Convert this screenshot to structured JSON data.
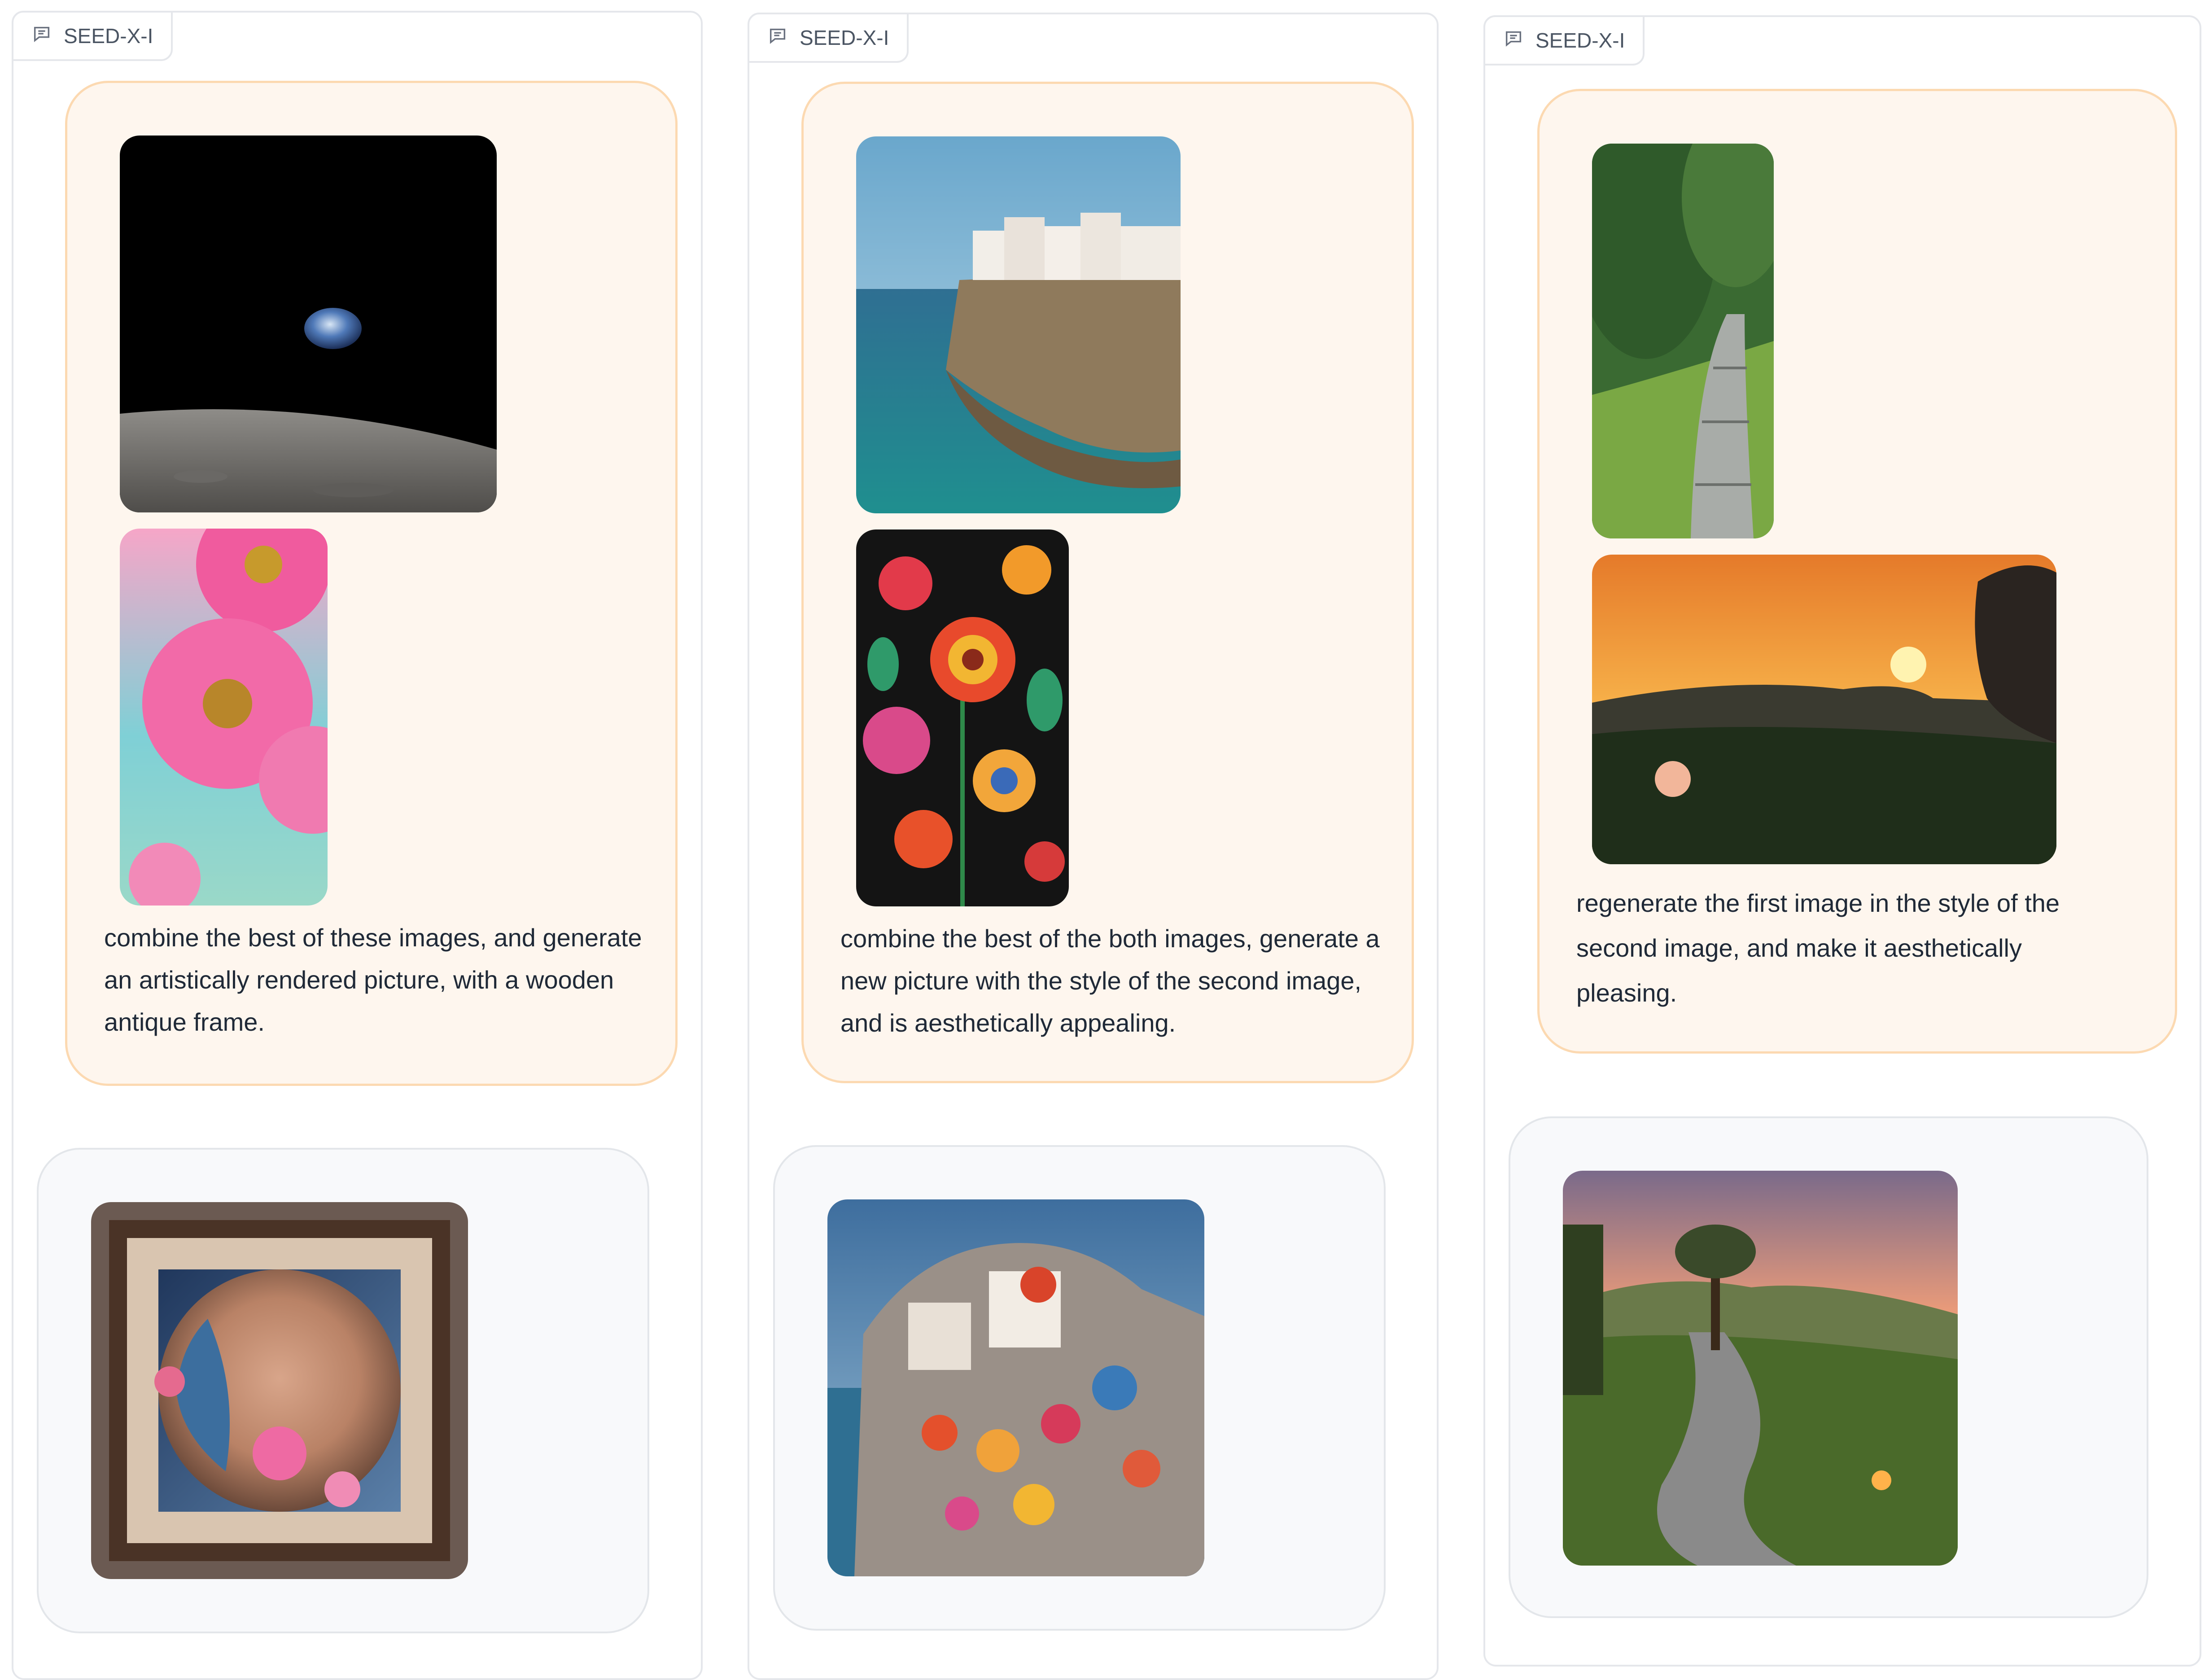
{
  "panels": [
    {
      "label": "SEED-X-I",
      "icon": "chat-icon",
      "user_message": {
        "text": "combine the best of these images, and generate an artistically rendered picture, with a wooden antique frame.",
        "images": [
          "earth-rising-over-moon-image",
          "pink-gerbera-flowers-image"
        ]
      },
      "bot_message": {
        "images": [
          "framed-planet-with-flowers-image"
        ]
      }
    },
    {
      "label": "SEED-X-I",
      "icon": "chat-icon",
      "user_message": {
        "text": "combine the best of the both images, generate a new picture with the style of the second image, and is aesthetically appealing.",
        "images": [
          "seaside-cliff-town-image",
          "embroidered-folk-flowers-image"
        ]
      },
      "bot_message": {
        "images": [
          "floral-embroidered-cliff-town-image"
        ]
      }
    },
    {
      "label": "SEED-X-I",
      "icon": "chat-icon",
      "user_message": {
        "text": "regenerate the first image in the style of the second image, and make it aesthetically pleasing.",
        "images": [
          "stone-garden-path-image",
          "tropical-sunset-image"
        ]
      },
      "bot_message": {
        "images": [
          "sunset-stone-path-image"
        ]
      }
    }
  ],
  "colors": {
    "user_bubble_bg": "#fef6ee",
    "user_bubble_border": "#fcd9b1",
    "bot_bubble_bg": "#f8f9fb",
    "panel_border": "#e5e7eb"
  }
}
